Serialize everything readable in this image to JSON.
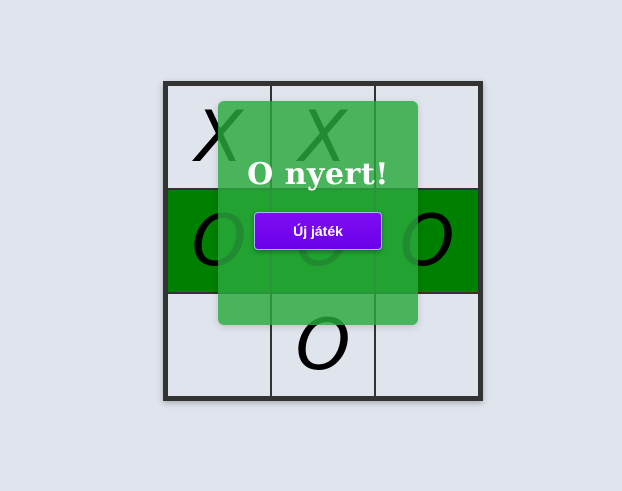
{
  "board": {
    "cells": [
      "X",
      "X",
      "",
      "O",
      "O",
      "O",
      "",
      "O",
      ""
    ],
    "winning_row": 1,
    "win_color": "#008000"
  },
  "result": {
    "title": "O nyert!",
    "new_game_label": "Új játék",
    "overlay_color": "#2aaa3c",
    "button_color": "#6f00ef"
  }
}
